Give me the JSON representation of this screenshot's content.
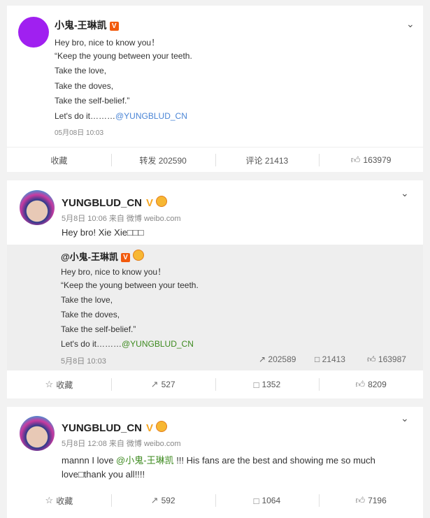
{
  "post1": {
    "author": "小鬼-王琳凯",
    "badge": "V",
    "lines": [
      "Hey bro, nice to know you！",
      "“Keep the young between your teeth.",
      "Take the love,",
      "Take the doves,",
      "Take the self-belief.”"
    ],
    "last_prefix": "Let's do it………",
    "mention": "@YUNGBLUD_CN",
    "time": "05月08日 10:03",
    "actions": {
      "fav": "收藏",
      "repost": "转发 202590",
      "comment": "评论 21413",
      "like": "163979"
    }
  },
  "post2": {
    "author": "YUNGBLUD_CN",
    "badge": "V",
    "meta": "5月8日 10:06 来自 微博 weibo.com",
    "text": "Hey bro! Xie Xie□□□",
    "quote": {
      "author": "@小鬼-王琳凯",
      "badge": "V",
      "lines": [
        "Hey bro, nice to know you！",
        "“Keep the young between your teeth.",
        "Take the love,",
        "Take the doves,",
        "Take the self-belief.”"
      ],
      "last_prefix": "Let's do it………",
      "mention": "@YUNGBLUD_CN",
      "time": "5月8日 10:03",
      "reposts": "202589",
      "comments": "21413",
      "likes": "163987"
    },
    "actions": {
      "fav": "收藏",
      "repost": "527",
      "comment": "1352",
      "like": "8209"
    }
  },
  "post3": {
    "author": "YUNGBLUD_CN",
    "badge": "V",
    "meta": "5月8日 12:08 来自 微博 weibo.com",
    "text_prefix": "mannn I love ",
    "mention": "@小鬼-王琳凯",
    "text_suffix": " !!! His fans are the best and showing me so much",
    "text_line2": "love□thank you all!!!!",
    "actions": {
      "fav": "收藏",
      "repost": "592",
      "comment": "1064",
      "like": "7196"
    }
  },
  "colors": {
    "accent_orange": "#f25a0d",
    "mention_green": "#3d8a1f",
    "mention_blue": "#4a85d6",
    "avatar1": "#a020f0"
  }
}
